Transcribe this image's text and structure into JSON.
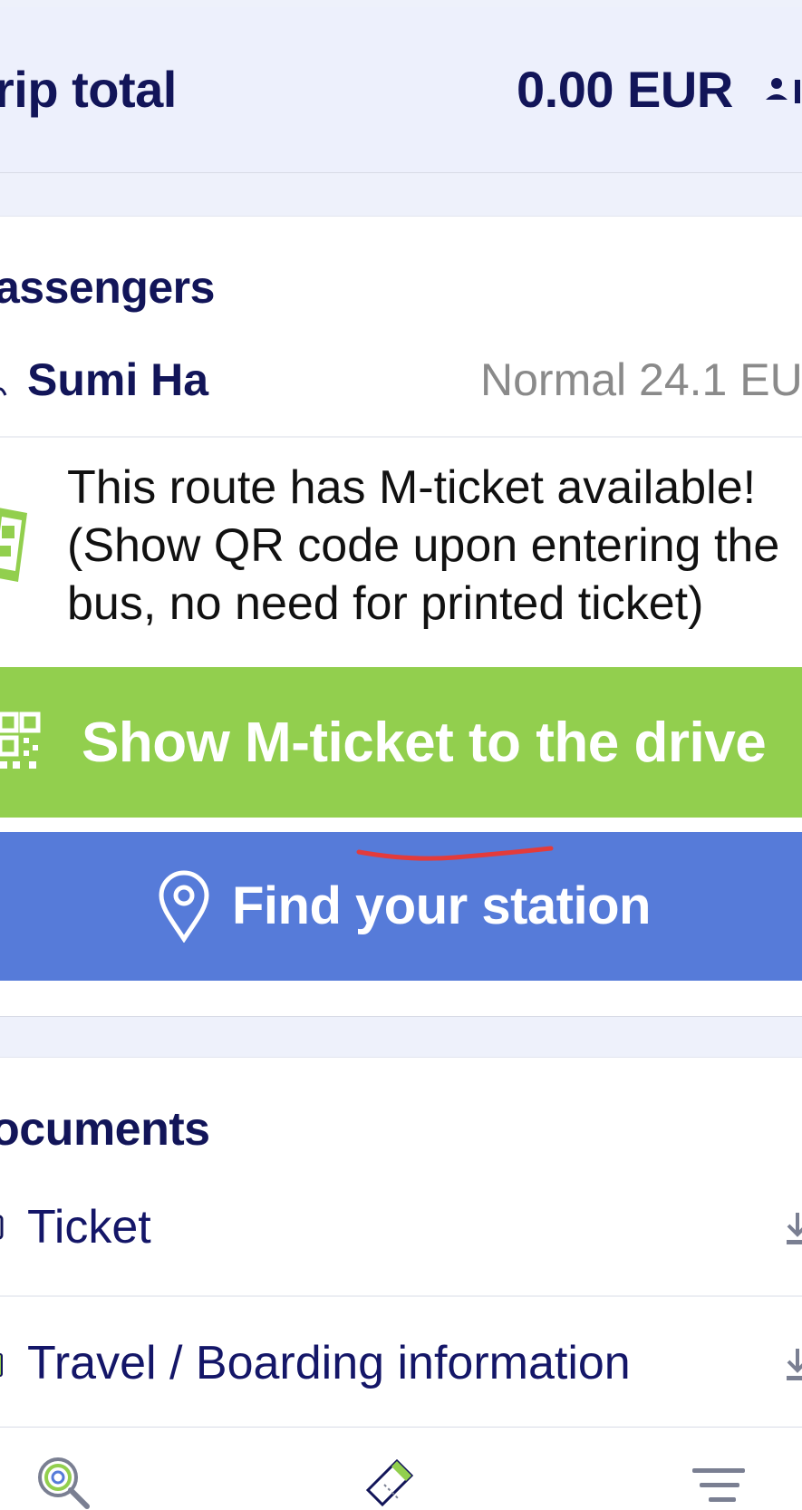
{
  "trip": {
    "total_label": "rip total",
    "total_value": "0.00 EUR"
  },
  "passengers": {
    "heading": "assengers",
    "items": [
      {
        "name": "Sumi Ha",
        "fare": "Normal 24.1 EU"
      }
    ]
  },
  "mticket": {
    "notice": "This route has M-ticket available!\n(Show QR code upon entering the\nbus, no need for printed ticket)",
    "button_label": "Show M-ticket to the drive"
  },
  "station": {
    "button_label": "Find your station"
  },
  "documents": {
    "heading": "ocuments",
    "items": [
      {
        "label": "Ticket"
      },
      {
        "label": "Travel / Boarding information"
      }
    ]
  },
  "icons": {
    "person": "person-icon",
    "passenger": "person-icon",
    "mticket_notice": "phone-ticket-icon",
    "qr": "qr-code-icon",
    "pin": "location-pin-icon",
    "document": "document-icon",
    "download": "download-icon",
    "nav_search": "search-icon",
    "nav_ticket": "ticket-icon",
    "nav_menu": "menu-icon"
  },
  "colors": {
    "navy_text": "#121559",
    "header_bg": "#edf0fc",
    "green_button": "#92cf4e",
    "blue_button": "#567bd9",
    "grey_text": "#8a8a8a",
    "annotation_red": "#e33b3b"
  }
}
